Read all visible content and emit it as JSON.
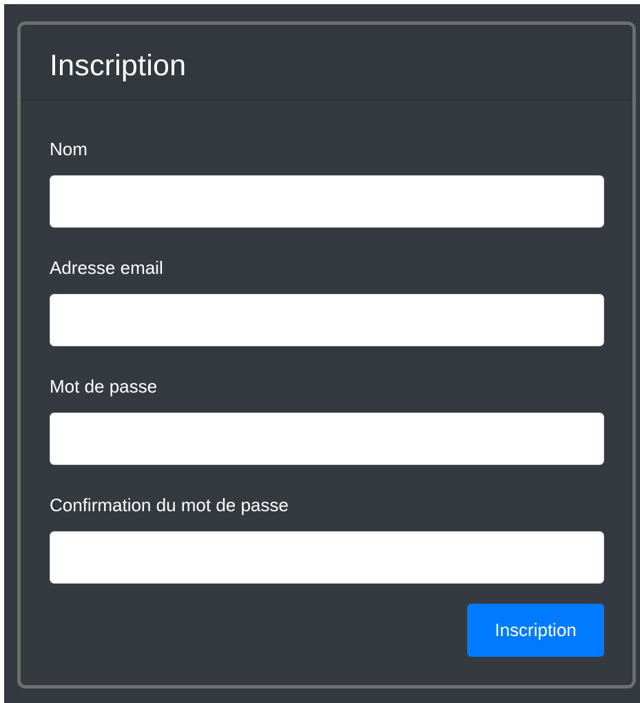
{
  "form": {
    "title": "Inscription",
    "fields": [
      {
        "label": "Nom",
        "value": "",
        "placeholder": ""
      },
      {
        "label": "Adresse email",
        "value": "",
        "placeholder": ""
      },
      {
        "label": "Mot de passe",
        "value": "",
        "placeholder": ""
      },
      {
        "label": "Confirmation du mot de passe",
        "value": "",
        "placeholder": ""
      }
    ],
    "submit_label": "Inscription"
  },
  "colors": {
    "background": "#343a40",
    "card_border": "#6c6e70",
    "input_background": "#ffffff",
    "button_primary": "#007bff",
    "text": "#ffffff"
  }
}
